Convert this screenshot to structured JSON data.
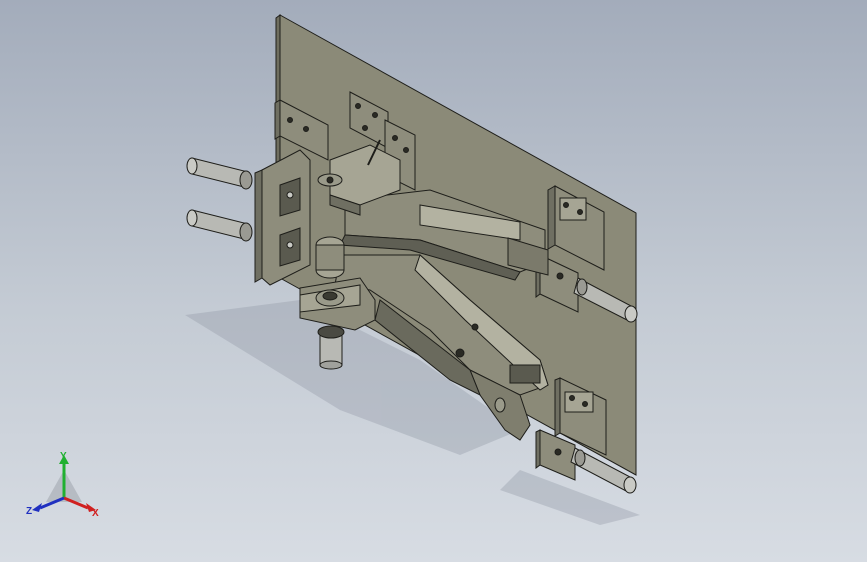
{
  "viewport": {
    "background_top": "#a3acbb",
    "background_bottom": "#d7dce3",
    "model": "welding-fixture-assembly"
  },
  "colors": {
    "plate_face": "#8b8a78",
    "plate_edge": "#6f6e5f",
    "part_dark": "#6f6f62",
    "part_light": "#a6a594",
    "rod": "#b8b9b4",
    "outline": "#1e1e1a"
  },
  "triad": {
    "x_label": "X",
    "y_label": "Y",
    "z_label": "Z",
    "x_color": "#d02020",
    "y_color": "#20b030",
    "z_color": "#2030c0"
  }
}
